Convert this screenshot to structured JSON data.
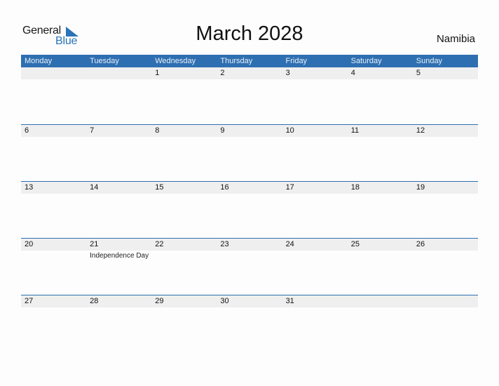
{
  "logo": {
    "general": "General",
    "blue": "Blue"
  },
  "title": "March 2028",
  "country": "Namibia",
  "colors": {
    "accent": "#2e6fb1",
    "strip": "#efefef"
  },
  "weekdays": [
    "Monday",
    "Tuesday",
    "Wednesday",
    "Thursday",
    "Friday",
    "Saturday",
    "Sunday"
  ],
  "weeks": [
    [
      {
        "day": ""
      },
      {
        "day": ""
      },
      {
        "day": "1"
      },
      {
        "day": "2"
      },
      {
        "day": "3"
      },
      {
        "day": "4"
      },
      {
        "day": "5"
      }
    ],
    [
      {
        "day": "6"
      },
      {
        "day": "7"
      },
      {
        "day": "8"
      },
      {
        "day": "9"
      },
      {
        "day": "10"
      },
      {
        "day": "11"
      },
      {
        "day": "12"
      }
    ],
    [
      {
        "day": "13"
      },
      {
        "day": "14"
      },
      {
        "day": "15"
      },
      {
        "day": "16"
      },
      {
        "day": "17"
      },
      {
        "day": "18"
      },
      {
        "day": "19"
      }
    ],
    [
      {
        "day": "20"
      },
      {
        "day": "21",
        "holiday": "Independence Day"
      },
      {
        "day": "22"
      },
      {
        "day": "23"
      },
      {
        "day": "24"
      },
      {
        "day": "25"
      },
      {
        "day": "26"
      }
    ],
    [
      {
        "day": "27"
      },
      {
        "day": "28"
      },
      {
        "day": "29"
      },
      {
        "day": "30"
      },
      {
        "day": "31"
      },
      {
        "day": ""
      },
      {
        "day": ""
      }
    ]
  ]
}
